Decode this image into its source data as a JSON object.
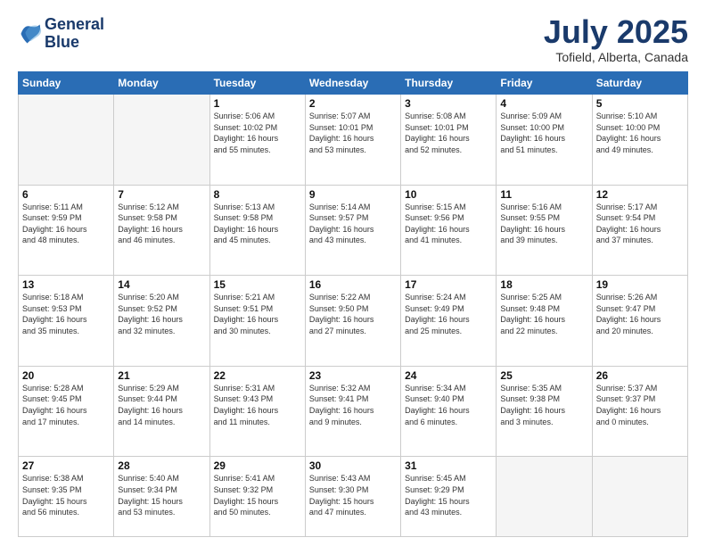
{
  "header": {
    "logo_line1": "General",
    "logo_line2": "Blue",
    "month": "July 2025",
    "location": "Tofield, Alberta, Canada"
  },
  "days_of_week": [
    "Sunday",
    "Monday",
    "Tuesday",
    "Wednesday",
    "Thursday",
    "Friday",
    "Saturday"
  ],
  "weeks": [
    [
      {
        "day": "",
        "info": ""
      },
      {
        "day": "",
        "info": ""
      },
      {
        "day": "1",
        "info": "Sunrise: 5:06 AM\nSunset: 10:02 PM\nDaylight: 16 hours\nand 55 minutes."
      },
      {
        "day": "2",
        "info": "Sunrise: 5:07 AM\nSunset: 10:01 PM\nDaylight: 16 hours\nand 53 minutes."
      },
      {
        "day": "3",
        "info": "Sunrise: 5:08 AM\nSunset: 10:01 PM\nDaylight: 16 hours\nand 52 minutes."
      },
      {
        "day": "4",
        "info": "Sunrise: 5:09 AM\nSunset: 10:00 PM\nDaylight: 16 hours\nand 51 minutes."
      },
      {
        "day": "5",
        "info": "Sunrise: 5:10 AM\nSunset: 10:00 PM\nDaylight: 16 hours\nand 49 minutes."
      }
    ],
    [
      {
        "day": "6",
        "info": "Sunrise: 5:11 AM\nSunset: 9:59 PM\nDaylight: 16 hours\nand 48 minutes."
      },
      {
        "day": "7",
        "info": "Sunrise: 5:12 AM\nSunset: 9:58 PM\nDaylight: 16 hours\nand 46 minutes."
      },
      {
        "day": "8",
        "info": "Sunrise: 5:13 AM\nSunset: 9:58 PM\nDaylight: 16 hours\nand 45 minutes."
      },
      {
        "day": "9",
        "info": "Sunrise: 5:14 AM\nSunset: 9:57 PM\nDaylight: 16 hours\nand 43 minutes."
      },
      {
        "day": "10",
        "info": "Sunrise: 5:15 AM\nSunset: 9:56 PM\nDaylight: 16 hours\nand 41 minutes."
      },
      {
        "day": "11",
        "info": "Sunrise: 5:16 AM\nSunset: 9:55 PM\nDaylight: 16 hours\nand 39 minutes."
      },
      {
        "day": "12",
        "info": "Sunrise: 5:17 AM\nSunset: 9:54 PM\nDaylight: 16 hours\nand 37 minutes."
      }
    ],
    [
      {
        "day": "13",
        "info": "Sunrise: 5:18 AM\nSunset: 9:53 PM\nDaylight: 16 hours\nand 35 minutes."
      },
      {
        "day": "14",
        "info": "Sunrise: 5:20 AM\nSunset: 9:52 PM\nDaylight: 16 hours\nand 32 minutes."
      },
      {
        "day": "15",
        "info": "Sunrise: 5:21 AM\nSunset: 9:51 PM\nDaylight: 16 hours\nand 30 minutes."
      },
      {
        "day": "16",
        "info": "Sunrise: 5:22 AM\nSunset: 9:50 PM\nDaylight: 16 hours\nand 27 minutes."
      },
      {
        "day": "17",
        "info": "Sunrise: 5:24 AM\nSunset: 9:49 PM\nDaylight: 16 hours\nand 25 minutes."
      },
      {
        "day": "18",
        "info": "Sunrise: 5:25 AM\nSunset: 9:48 PM\nDaylight: 16 hours\nand 22 minutes."
      },
      {
        "day": "19",
        "info": "Sunrise: 5:26 AM\nSunset: 9:47 PM\nDaylight: 16 hours\nand 20 minutes."
      }
    ],
    [
      {
        "day": "20",
        "info": "Sunrise: 5:28 AM\nSunset: 9:45 PM\nDaylight: 16 hours\nand 17 minutes."
      },
      {
        "day": "21",
        "info": "Sunrise: 5:29 AM\nSunset: 9:44 PM\nDaylight: 16 hours\nand 14 minutes."
      },
      {
        "day": "22",
        "info": "Sunrise: 5:31 AM\nSunset: 9:43 PM\nDaylight: 16 hours\nand 11 minutes."
      },
      {
        "day": "23",
        "info": "Sunrise: 5:32 AM\nSunset: 9:41 PM\nDaylight: 16 hours\nand 9 minutes."
      },
      {
        "day": "24",
        "info": "Sunrise: 5:34 AM\nSunset: 9:40 PM\nDaylight: 16 hours\nand 6 minutes."
      },
      {
        "day": "25",
        "info": "Sunrise: 5:35 AM\nSunset: 9:38 PM\nDaylight: 16 hours\nand 3 minutes."
      },
      {
        "day": "26",
        "info": "Sunrise: 5:37 AM\nSunset: 9:37 PM\nDaylight: 16 hours\nand 0 minutes."
      }
    ],
    [
      {
        "day": "27",
        "info": "Sunrise: 5:38 AM\nSunset: 9:35 PM\nDaylight: 15 hours\nand 56 minutes."
      },
      {
        "day": "28",
        "info": "Sunrise: 5:40 AM\nSunset: 9:34 PM\nDaylight: 15 hours\nand 53 minutes."
      },
      {
        "day": "29",
        "info": "Sunrise: 5:41 AM\nSunset: 9:32 PM\nDaylight: 15 hours\nand 50 minutes."
      },
      {
        "day": "30",
        "info": "Sunrise: 5:43 AM\nSunset: 9:30 PM\nDaylight: 15 hours\nand 47 minutes."
      },
      {
        "day": "31",
        "info": "Sunrise: 5:45 AM\nSunset: 9:29 PM\nDaylight: 15 hours\nand 43 minutes."
      },
      {
        "day": "",
        "info": ""
      },
      {
        "day": "",
        "info": ""
      }
    ]
  ]
}
